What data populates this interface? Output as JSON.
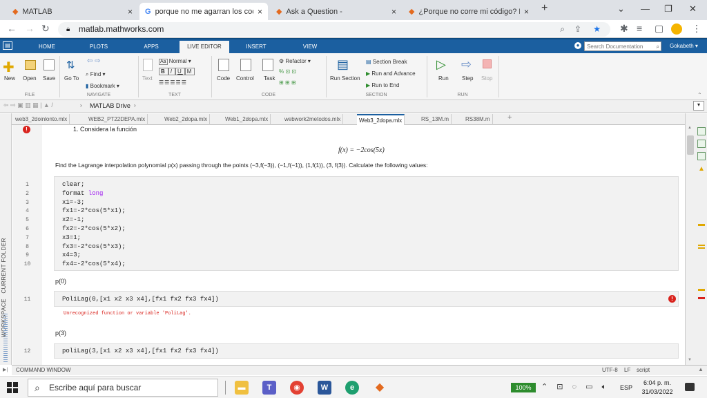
{
  "browser": {
    "tabs": [
      {
        "title": "MATLAB",
        "close": "×"
      },
      {
        "title": "porque no me agarran los codig",
        "close": "×"
      },
      {
        "title": "Ask a Question -",
        "close": "×"
      },
      {
        "title": "¿Porque no corre mi código? No",
        "close": "×"
      }
    ],
    "new_tab": "+",
    "url": "matlab.mathworks.com"
  },
  "matlab": {
    "tabs": [
      "HOME",
      "PLOTS",
      "APPS",
      "LIVE EDITOR",
      "INSERT",
      "VIEW"
    ],
    "search_placeholder": "Search Documentation",
    "user": "Gokabeth",
    "ribbon": {
      "file": {
        "new": "New",
        "open": "Open",
        "save": "Save",
        "section": "FILE"
      },
      "navigate": {
        "goto": "Go To",
        "find": "Find",
        "bookmark": "Bookmark",
        "section": "NAVIGATE"
      },
      "text": {
        "text": "Text",
        "normal": "Normal",
        "section": "TEXT"
      },
      "code": {
        "code": "Code",
        "control": "Control",
        "task": "Task",
        "refactor": "Refactor",
        "section": "CODE"
      },
      "section": {
        "run_section": "Run Section",
        "section_break": "Section Break",
        "run_advance": "Run and Advance",
        "run_end": "Run to End",
        "section": "SECTION"
      },
      "run": {
        "run": "Run",
        "step": "Step",
        "stop": "Stop",
        "section": "RUN"
      }
    },
    "path": "MATLAB Drive",
    "file_tabs": [
      "web3_2doinlonto.mlx",
      "WEB2_PT22DEPA.mlx",
      "Web2_2dopa.mlx",
      "Web1_2dopa.mlx",
      "webwork2metodos.mlx",
      "Web3_2dopa.mlx",
      "RS_13M.m",
      "RS38M.m"
    ],
    "side_labels": {
      "current_folder": "CURRENT FOLDER",
      "workspace": "WORKSPACE"
    },
    "editor": {
      "heading": "1. Considera la función",
      "formula": "f(x) = −2cos(5x)",
      "problem": "Find the Lagrange interpolation polynomial p(x) passing through the points (−3,f(−3)), (−1,f(−1)), (1,f(1)), (3, f(3)). Calculate the following values:",
      "code1": [
        {
          "n": "1",
          "t": "clear;"
        },
        {
          "n": "2",
          "t": "format ",
          "k": "long"
        },
        {
          "n": "3",
          "t": "x1=-3;"
        },
        {
          "n": "4",
          "t": "fx1=-2*cos(5*x1);"
        },
        {
          "n": "5",
          "t": "x2=-1;"
        },
        {
          "n": "6",
          "t": "fx2=-2*cos(5*x2);"
        },
        {
          "n": "7",
          "t": "x3=1;"
        },
        {
          "n": "8",
          "t": "fx3=-2*cos(5*x3);"
        },
        {
          "n": "9",
          "t": "x4=3;"
        },
        {
          "n": "10",
          "t": "fx4=-2*cos(5*x4);"
        }
      ],
      "label_p0": "p(0)",
      "code2": {
        "n": "11",
        "t": "PoliLag(0,[x1 x2 x3 x4],[fx1 fx2 fx3 fx4])"
      },
      "error": "Unrecognized function or variable 'PoliLag'.",
      "label_p3": "p(3)",
      "code3": {
        "n": "12",
        "t": "poliLag(3,[x1 x2 x3 x4],[fx1 fx2 fx3 fx4])"
      }
    },
    "command_window": "COMMAND WINDOW",
    "status": {
      "encoding": "UTF-8",
      "eol": "LF",
      "mode": "script"
    }
  },
  "taskbar": {
    "search": "Escribe aquí para buscar",
    "zoom": "100%",
    "lang": "ESP",
    "time": "6:04 p. m.",
    "date": "31/03/2022"
  }
}
